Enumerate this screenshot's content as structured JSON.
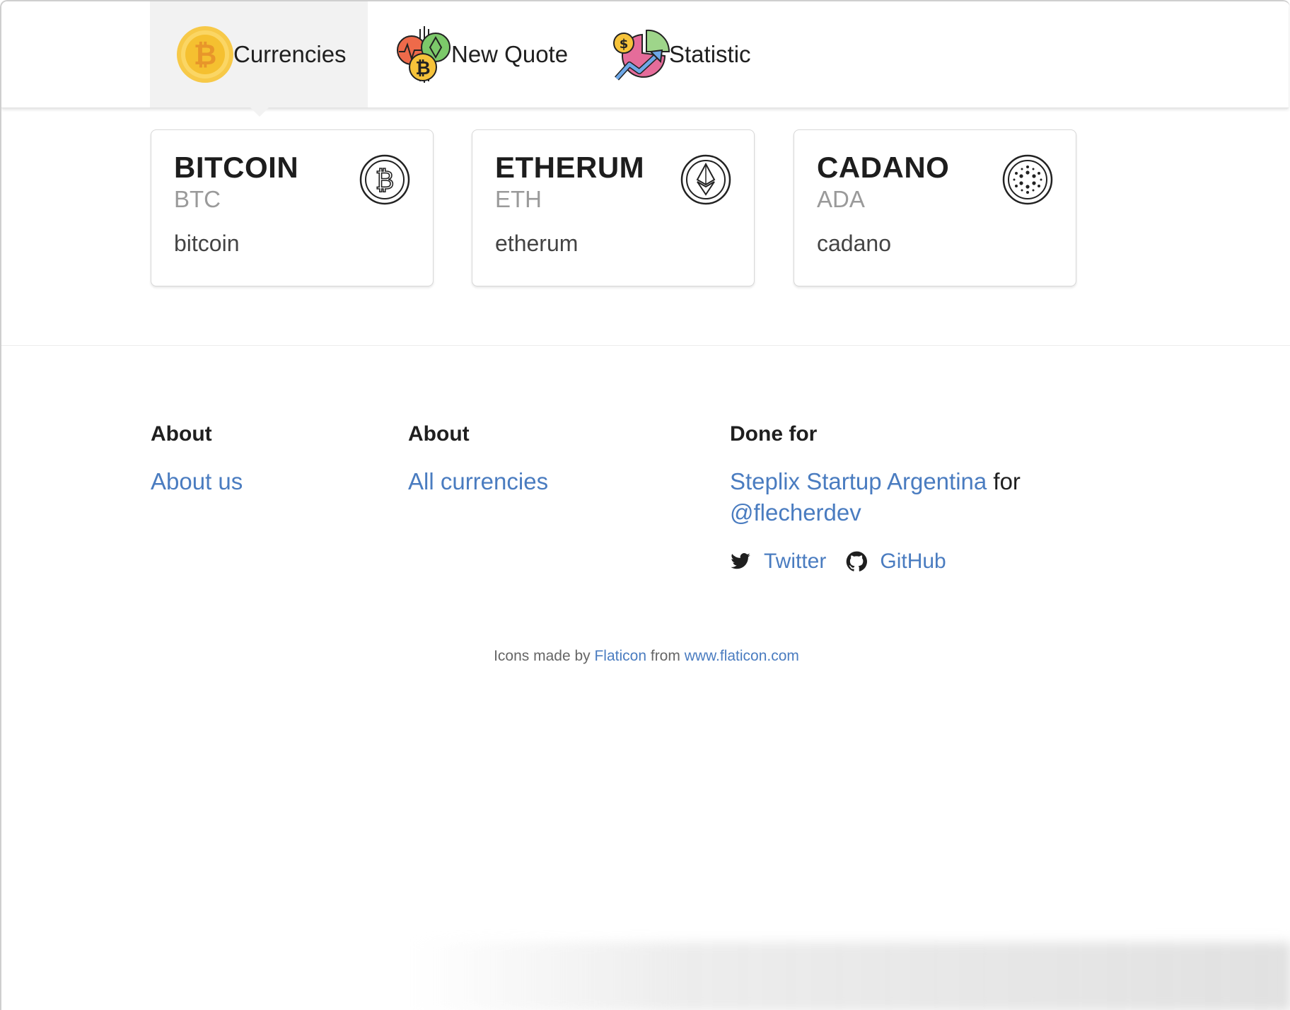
{
  "nav": {
    "items": [
      {
        "label": "Currencies",
        "icon": "bitcoin-coin-icon",
        "active": true
      },
      {
        "label": "New Quote",
        "icon": "crypto-quote-icon",
        "active": false
      },
      {
        "label": "Statistic",
        "icon": "statistic-chart-icon",
        "active": false
      }
    ]
  },
  "cards": [
    {
      "name": "BITCOIN",
      "symbol": "BTC",
      "slug": "bitcoin",
      "icon": "bitcoin-outline-icon"
    },
    {
      "name": "ETHERUM",
      "symbol": "ETH",
      "slug": "etherum",
      "icon": "ethereum-outline-icon"
    },
    {
      "name": "CADANO",
      "symbol": "ADA",
      "slug": "cadano",
      "icon": "cardano-outline-icon"
    }
  ],
  "footer": {
    "col1": {
      "heading": "About",
      "link": "About us"
    },
    "col2": {
      "heading": "About",
      "link": "All currencies"
    },
    "col3": {
      "heading": "Done for",
      "startup_link": "Steplix Startup Argentina",
      "for_text": "for",
      "handle_link": "@flecherdev",
      "twitter": "Twitter",
      "github": "GitHub"
    },
    "credits": {
      "prefix": "Icons made by",
      "author": "Flaticon",
      "middle": "from",
      "site": "www.flaticon.com"
    }
  },
  "colors": {
    "link": "#4a7cc0",
    "active_tab_bg": "#f2f2f2",
    "bitcoin_gold": "#f5c518"
  }
}
